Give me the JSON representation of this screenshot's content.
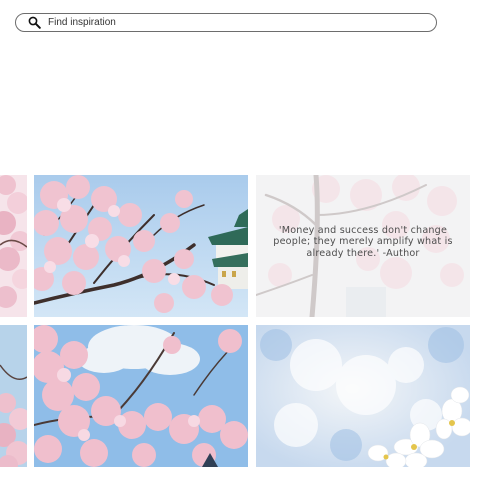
{
  "search": {
    "placeholder": "Find inspiration",
    "icon": "search-icon"
  },
  "gallery": {
    "tiles": [
      {
        "subject": "cherry blossom branches",
        "kind": "photo"
      },
      {
        "subject": "cherry blossoms with castle roof against blue sky",
        "kind": "photo"
      },
      {
        "subject": "faded cherry blossom photo with quote",
        "kind": "quote"
      },
      {
        "subject": "cherry blossom branches",
        "kind": "photo"
      },
      {
        "subject": "cherry blossoms against blue sky with clouds",
        "kind": "photo"
      },
      {
        "subject": "blurred white blossoms close-up",
        "kind": "photo"
      }
    ],
    "quote": {
      "text": "'Money and success don't change people; they merely amplify what is already there.' -Author"
    }
  },
  "colors": {
    "sky": "#b9d7ef",
    "blossom_pink": "#f1c6d2",
    "branch": "#4a3a36",
    "search_border": "#6d6d6d"
  }
}
